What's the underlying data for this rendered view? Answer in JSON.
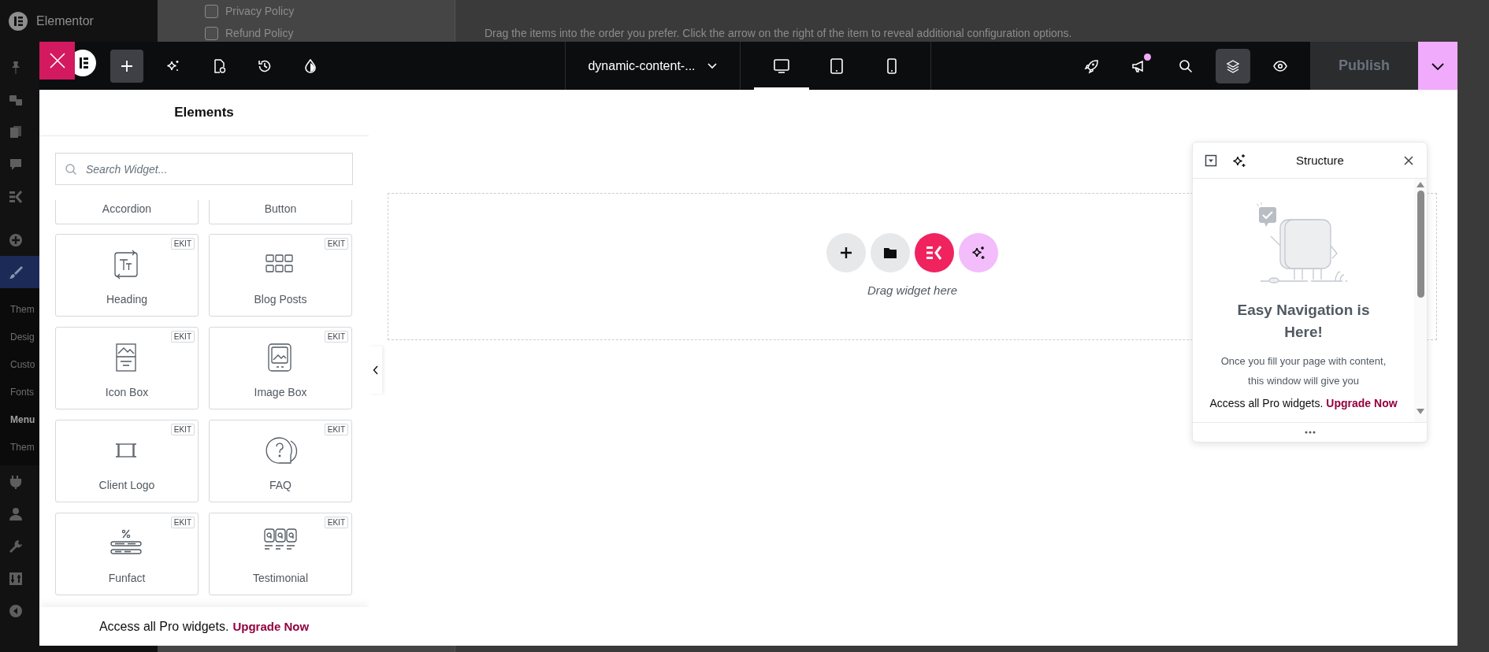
{
  "backdrop": {
    "brand": "Elementor",
    "menu": [
      {
        "selected": false
      },
      {
        "selected": false
      },
      {
        "selected": false
      },
      {
        "selected": false
      },
      {
        "selected": false
      },
      {
        "selected": false
      },
      {
        "selected": true,
        "children": [
          {
            "label": "Them",
            "selected": false
          },
          {
            "label": "Desig",
            "selected": false
          },
          {
            "label": "Custo",
            "selected": false
          },
          {
            "label": "Fonts",
            "selected": false
          },
          {
            "label": "Menu",
            "selected": true
          },
          {
            "label": "Them",
            "selected": false
          }
        ]
      },
      {
        "selected": false
      },
      {
        "selected": false
      },
      {
        "selected": false
      },
      {
        "selected": false
      },
      {
        "selected": false
      }
    ],
    "checkboxes": [
      {
        "label": "Privacy Policy",
        "checked": false
      },
      {
        "label": "Refund Policy",
        "checked": false
      }
    ],
    "instructions": "Drag the items into the order you prefer. Click the arrow on the right of the item to reveal additional configuration options."
  },
  "top_bar": {
    "title": "dynamic-content-...",
    "tools": [
      {
        "selected": true
      },
      {
        "selected": false
      },
      {
        "selected": false
      },
      {
        "selected": false
      },
      {
        "selected": false
      }
    ],
    "devices": [
      {
        "selected": true
      },
      {
        "selected": false
      },
      {
        "selected": false
      }
    ],
    "right_tools": [
      {
        "selected": false,
        "notification": false
      },
      {
        "selected": false,
        "notification": true
      },
      {
        "selected": false,
        "notification": false
      },
      {
        "selected": true,
        "notification": false
      },
      {
        "selected": false,
        "notification": false
      }
    ],
    "publish": {
      "label": "Publish",
      "disabled": true
    }
  },
  "elements_panel": {
    "title": "Elements",
    "search": {
      "placeholder": "Search Widget..."
    },
    "widgets": [
      {
        "label": "Accordion",
        "kind": "clipped"
      },
      {
        "label": "Button",
        "kind": "clipped"
      },
      {
        "label": "Heading",
        "kind": "widget",
        "badge": "EKIT"
      },
      {
        "label": "Blog Posts",
        "kind": "widget",
        "badge": "EKIT"
      },
      {
        "label": "Icon Box",
        "kind": "widget",
        "badge": "EKIT"
      },
      {
        "label": "Image Box",
        "kind": "widget",
        "badge": "EKIT"
      },
      {
        "label": "Client Logo",
        "kind": "widget",
        "badge": "EKIT"
      },
      {
        "label": "FAQ",
        "kind": "widget",
        "badge": "EKIT"
      },
      {
        "label": "Funfact",
        "kind": "widget",
        "badge": "EKIT"
      },
      {
        "label": "Testimonial",
        "kind": "widget",
        "badge": "EKIT"
      }
    ],
    "promo": {
      "text": "Access all Pro widgets.",
      "link": "Upgrade Now"
    }
  },
  "canvas": {
    "drop_hint": "Drag widget here"
  },
  "structure": {
    "title": "Structure",
    "heading": "Easy Navigation is Here!",
    "body": "Once you fill your page with content, this window will give you",
    "promo": {
      "text": "Access all Pro widgets.",
      "link": "Upgrade Now"
    }
  }
}
